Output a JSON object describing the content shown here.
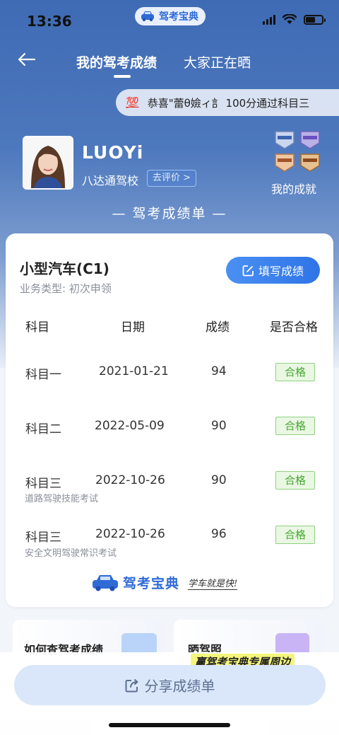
{
  "status": {
    "time": "13:36",
    "app_name": "驾考宝典"
  },
  "nav": {
    "tab_mine": "我的驾考成绩",
    "tab_others": "大家正在晒"
  },
  "banner": {
    "emoji": "💯",
    "text": "恭喜\"蕾θ嬐ィ訁 100分通过科目三"
  },
  "profile": {
    "name": "LUOYi",
    "school": "八达通驾校",
    "review_label": "去评价 >",
    "achievements_label": "我的成就"
  },
  "sheet_title": "— 驾考成绩单 —",
  "card": {
    "car_type": "小型汽车(C1)",
    "business_type": "业务类型:  初次申领",
    "fill_label": "填写成绩",
    "headers": [
      "科目",
      "日期",
      "成绩",
      "是否合格"
    ],
    "rows": [
      {
        "subject": "科目一",
        "date": "2021-01-21",
        "score": "94",
        "result": "合格",
        "note": ""
      },
      {
        "subject": "科目二",
        "date": "2022-05-09",
        "score": "90",
        "result": "合格",
        "note": ""
      },
      {
        "subject": "科目三",
        "date": "2022-10-26",
        "score": "90",
        "result": "合格",
        "note": "道路驾驶技能考试"
      },
      {
        "subject": "科目三",
        "date": "2022-10-26",
        "score": "96",
        "result": "合格",
        "note": "安全文明驾驶常识考试"
      }
    ],
    "brand": "驾考宝典",
    "slogan": "学车就是快!"
  },
  "bottom": {
    "card1_title": "如何查驾考成绩",
    "card2_title": "晒驾照",
    "promo": "赢驾考宝典专属周边",
    "share_label": "分享成绩单"
  },
  "colors": {
    "accent": "#2f74e6",
    "pass_green": "#46a832",
    "hero_blue": "#4d78bd"
  }
}
